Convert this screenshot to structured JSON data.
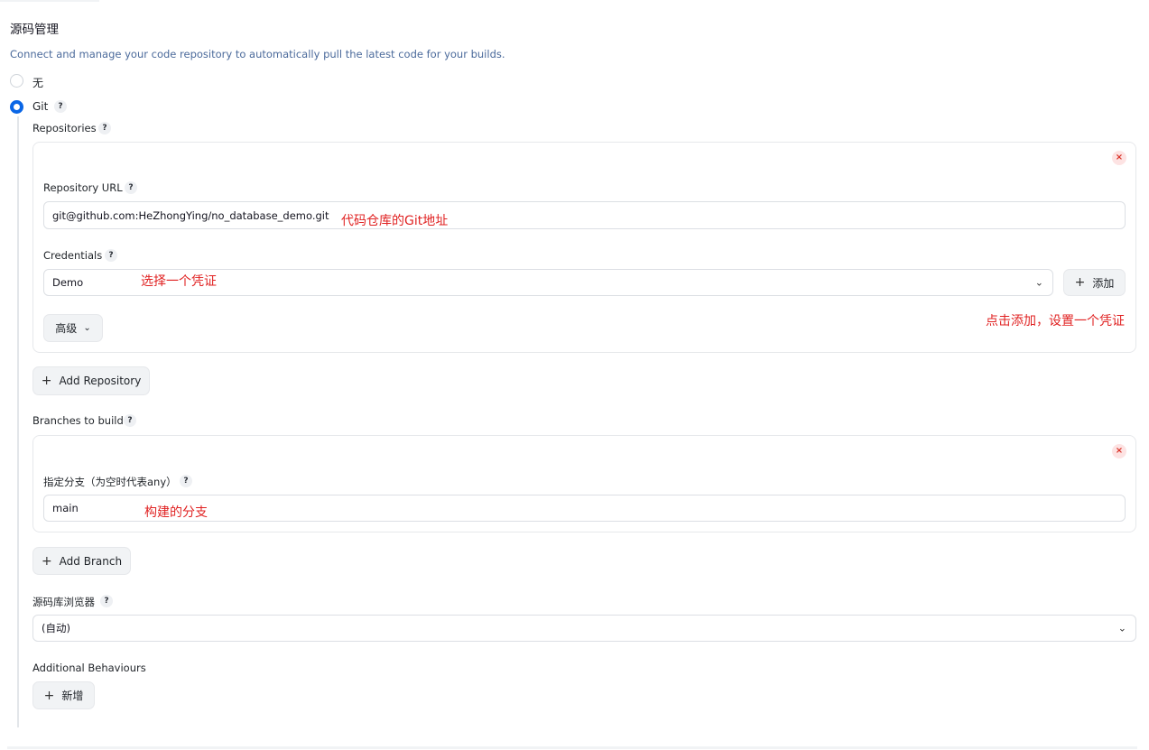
{
  "section": {
    "title": "源码管理",
    "description": "Connect and manage your code repository to automatically pull the latest code for your builds."
  },
  "scm_options": [
    {
      "label": "无",
      "selected": false
    },
    {
      "label": "Git",
      "selected": true
    }
  ],
  "help_mark": "?",
  "repositories": {
    "label": "Repositories",
    "delete_icon": "×",
    "url_label": "Repository URL",
    "url_value": "git@github.com:HeZhongYing/no_database_demo.git",
    "credentials_label": "Credentials",
    "credentials_value": "Demo",
    "add_credential_label": "添加",
    "advanced_label": "高级",
    "add_repository_label": "Add Repository"
  },
  "branches": {
    "label": "Branches to build",
    "delete_icon": "×",
    "specifier_label": "指定分支（为空时代表any）",
    "specifier_value": "main",
    "add_branch_label": "Add Branch"
  },
  "browser": {
    "label": "源码库浏览器",
    "value": "(自动)"
  },
  "behaviours": {
    "label": "Additional Behaviours",
    "add_label": "新增"
  },
  "annotations": {
    "repo_url": "代码仓库的Git地址",
    "credentials": "选择一个凭证",
    "add_credential": "点击添加，设置一个凭证",
    "branch": "构建的分支"
  },
  "colors": {
    "accent": "#0a66e6",
    "annotation": "#e02222",
    "description": "#4b6a9b"
  }
}
